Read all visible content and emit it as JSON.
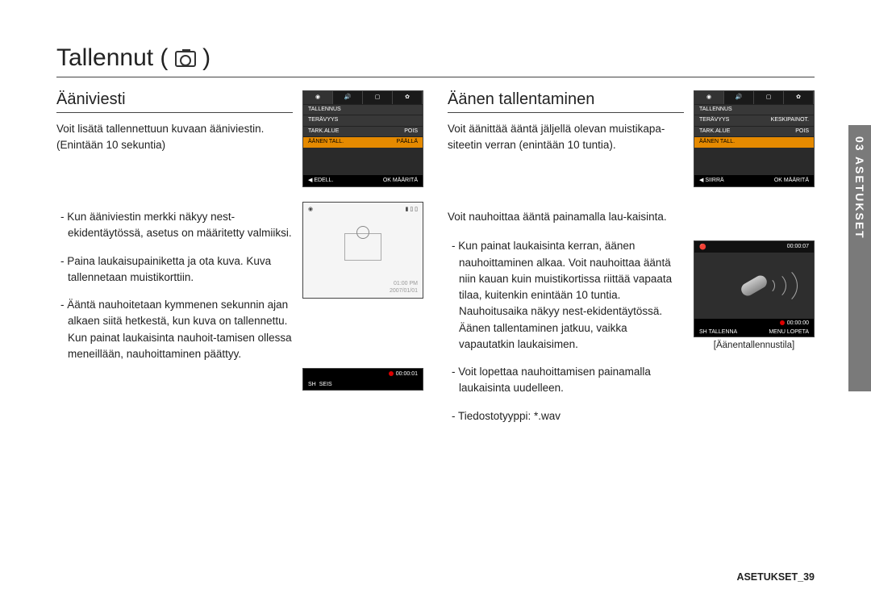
{
  "page": {
    "title_prefix": "Tallennut (",
    "title_suffix": ")"
  },
  "sideTab": "03 ASETUKSET",
  "footer": {
    "label": "ASETUKSET_",
    "page": "39"
  },
  "left": {
    "heading": "Ääniviesti",
    "intro": "Voit lisätä tallennettuun kuvaan ääniviestin. (Enintään 10 sekuntia)",
    "bul1": "- Kun ääniviestin merkki näkyy nest-ekidentäytössä, asetus on määritetty valmiiksi.",
    "bul2": "- Paina laukaisupainiketta ja ota kuva. Kuva tallennetaan muistikorttiin.",
    "bul3": "- Ääntä nauhoitetaan kymmenen sekunnin ajan alkaen siitä hetkestä, kun kuva on tallennettu. Kun painat laukaisinta nauhoit-tamisen ollessa meneillään, nauhoittaminen päättyy."
  },
  "right": {
    "heading": "Äänen tallentaminen",
    "intro": "Voit äänittää ääntä jäljellä olevan muistikapa-siteetin verran (enintään 10 tuntia).",
    "para1": "Voit nauhoittaa ääntä painamalla lau-kaisinta.",
    "bul1": "- Kun painat laukaisinta kerran, äänen nauhoittaminen alkaa. Voit nauhoittaa ääntä niin kauan kuin muistikortissa riittää vapaata tilaa, kuitenkin enintään 10 tuntia. Nauhoitusaika näkyy nest-ekidentäytössä. Äänen tallentaminen jatkuu, vaikka vapautatkin laukaisimen.",
    "bul2": "- Voit lopettaa nauhoittamisen painamalla laukaisinta uudelleen.",
    "bul3": "- Tiedostotyyppi: *.wav",
    "caption": "[Äänentallennustila]"
  },
  "lcd1": {
    "menuTitle": "TALLENNUS",
    "r1_l": "TERÄVYYS",
    "r1_r": "",
    "r2_l": "TARK.ALUE",
    "r2_r": "POIS",
    "r3_l": "ÄÄNEN TALL.",
    "r3_r": "PÄÄLLÄ",
    "f_l": "◀  EDELL.",
    "f_r": "OK  MÄÄRITÄ"
  },
  "lcd2": {
    "time": "01:00 PM",
    "date": "2007/01/01"
  },
  "lcd3": {
    "timer": "00:00:01",
    "sh": "SH",
    "stop": "SEIS"
  },
  "lcd4": {
    "menuTitle": "TALLENNUS",
    "r1_l": "TERÄVYYS",
    "r1_r": "KESKIPAINOT.",
    "r2_l": "TARK.ALUE",
    "r2_r": "POIS",
    "r3_l": "ÄÄNEN TALL.",
    "r3_r": "",
    "f_l": "◀  SIIRRÄ",
    "f_r": "OK  MÄÄRITÄ"
  },
  "lcd5": {
    "hdr_time": "00:00:07",
    "timer": "00:00:00",
    "sh": "SH",
    "rec": "TALLENNA",
    "menu": "MENU",
    "exit": "LOPETA"
  }
}
